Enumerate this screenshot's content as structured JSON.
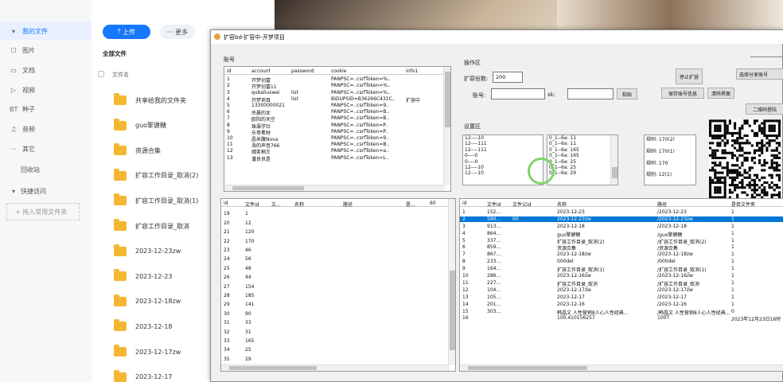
{
  "sidebar": {
    "items": [
      {
        "label": "我的文件",
        "icon": "chevron-down-icon",
        "active": true
      },
      {
        "label": "图片",
        "icon": "image-icon"
      },
      {
        "label": "文档",
        "icon": "document-icon"
      },
      {
        "label": "视频",
        "icon": "video-icon"
      },
      {
        "label": "种子",
        "icon": "bt-icon"
      },
      {
        "label": "音频",
        "icon": "headphones-icon"
      },
      {
        "label": "其它",
        "icon": "more-icon"
      },
      {
        "label": "回收站",
        "icon": ""
      },
      {
        "label": "快捷访问",
        "icon": "chevron-down-icon"
      },
      {
        "label": "+ 拖入常用文件夹",
        "icon": ""
      }
    ]
  },
  "toolbar": {
    "upload": "上传",
    "more": "更多"
  },
  "files": {
    "header": "全部文件",
    "col_name": "文件名",
    "items": [
      "共享给我的文件夹",
      "guo擎健糖",
      "资源合集",
      "扩容工作目录_取消(2)",
      "扩容工作目录_取消(1)",
      "扩容工作目录_取消",
      "2023-12-23zw",
      "2023-12-23",
      "2023-12-18zw",
      "2023-12-18",
      "2023-12-17zw",
      "2023-12-17"
    ]
  },
  "window": {
    "title": "扩容bd-扩容中-开梦项目",
    "account_label": "账号",
    "ops_label": "操作区",
    "settings_label": "设置区",
    "expand_count_label": "扩容份数:",
    "expand_count_value": "200",
    "account_field_label": "账号:",
    "sk_label": "sk:",
    "paste_btn": "粘贴",
    "stop_btn": "停止扩容",
    "save_btn": "保存账号信息",
    "clear_btn": "清除界面",
    "select_share_btn": "选择分享账号",
    "qrcode_btn": "二维码登陆",
    "acc_headers": [
      "id",
      "account",
      "password",
      "cookie",
      "info1"
    ],
    "acc_rows": [
      [
        "1",
        "开梦创富",
        "",
        "PANPSC=..csrfToken=%..",
        ""
      ],
      [
        "2",
        "开梦创富11",
        "",
        "PANPSC=..csrfToken=%..",
        ""
      ],
      [
        "3",
        "qubaliuswei",
        "list",
        "PANPSC=..csrfToken=%..",
        ""
      ],
      [
        "4",
        "开梦项目",
        "list",
        "BIDUPSID=B36266C431C..",
        "扩容中"
      ],
      [
        "5",
        "13300000021",
        "",
        "PANPSC=..csrfToken=9..",
        ""
      ],
      [
        "6",
        "杀晨的女",
        "",
        "PANPSC=..csrfToken=B..",
        ""
      ],
      [
        "7",
        "欧阳的天空",
        "",
        "PANPSC=..csrfToken=B..",
        ""
      ],
      [
        "8",
        "珠瀛学社",
        "",
        "PANPSC=..csrfToken=P..",
        ""
      ],
      [
        "9",
        "乐哥素材",
        "",
        "PANPSC=..csrfToken=P..",
        ""
      ],
      [
        "10",
        "晶禾腹Nova",
        "",
        "PANPSC=..csrfToken=9..",
        ""
      ],
      [
        "11",
        "海的声音766",
        "",
        "PANPSC=..csrfToken=B..",
        ""
      ],
      [
        "12",
        "嫣茗桐王",
        "",
        "PANPSC=..csrfToken=a..",
        ""
      ],
      [
        "13",
        "潘良良是",
        "",
        "PANPSC=..csrfToken=L..",
        ""
      ]
    ],
    "set_col1": [
      "12----10",
      "12----111",
      "12----111",
      "0----0",
      "0----0",
      "12----10",
      "12----10"
    ],
    "set_col2": [
      "0_1--6a: 11",
      "0_1--6a: 11",
      "0_1--6a: 165",
      "0_1--6a: 165",
      "0_1--6a: 25",
      "0_1--6a: 25",
      "0_1--6a: 29"
    ],
    "set_col3": [
      "规则: 170(2)",
      "",
      "规则: 170(1)",
      "",
      "规则: 170",
      "",
      "规则: 12(1)"
    ],
    "left_headers": [
      "id",
      "文件id",
      "文...",
      "名称",
      "路径",
      "是...",
      "60"
    ],
    "left_rows": [
      [
        "19",
        "1"
      ],
      [
        "20",
        "12"
      ],
      [
        "21",
        "120"
      ],
      [
        "22",
        "170"
      ],
      [
        "23",
        "46"
      ],
      [
        "24",
        "56"
      ],
      [
        "25",
        "48"
      ],
      [
        "26",
        "44"
      ],
      [
        "27",
        "154"
      ],
      [
        "28",
        "185"
      ],
      [
        "29",
        "141"
      ],
      [
        "30",
        "90"
      ],
      [
        "31",
        "33"
      ],
      [
        "32",
        "31"
      ],
      [
        "33",
        "165"
      ],
      [
        "34",
        "25"
      ],
      [
        "35",
        "29"
      ]
    ],
    "right_headers": [
      "id",
      "文件id",
      "文件父id",
      "名称",
      "路径",
      "是否文件夹"
    ],
    "right_rows": [
      [
        "1",
        "152...",
        "",
        "2023-12-23",
        "/2023-12-23",
        "1"
      ],
      [
        "2",
        "590...",
        "00",
        "2023-12-23zw",
        "/2023-12-23zw",
        "1"
      ],
      [
        "3",
        "913...",
        "",
        "2023-12-18",
        "/2023-12-18",
        "1"
      ],
      [
        "4",
        "864...",
        "",
        "guo擎健糖",
        "/guo擎健糖",
        "1"
      ],
      [
        "5",
        "337...",
        "",
        "扩容工作目录_取消(2)",
        "/扩容工作目录_取消(2)",
        "1"
      ],
      [
        "6",
        "859...",
        "",
        "资源合集",
        "/资源合集",
        "1"
      ],
      [
        "7",
        "867...",
        "",
        "2023-12-18zw",
        "/2023-12-18zw",
        "1"
      ],
      [
        "8",
        "233...",
        "",
        "000del",
        "/000del",
        "1"
      ],
      [
        "9",
        "164...",
        "",
        "扩容工作目录_取消(1)",
        "/扩容工作目录_取消(1)",
        "1"
      ],
      [
        "10",
        "286...",
        "",
        "2023-12-16zw",
        "/2023-12-16zw",
        "1"
      ],
      [
        "11",
        "227...",
        "",
        "扩容工作目录_取消",
        "/扩容工作目录_取消",
        "1"
      ],
      [
        "12",
        "104...",
        "",
        "2023-12-17zw",
        "/2023-12-17zw",
        "1"
      ],
      [
        "13",
        "105...",
        "",
        "2023-12-17",
        "/2023-12-17",
        "1"
      ],
      [
        "14",
        "201...",
        "",
        "2023-12-16",
        "/2023-12-16",
        "1"
      ],
      [
        "15",
        "303...",
        "",
        "韩晶文 人性营销8人心人性经典...",
        "/韩晶文 人性营销8人心人性经典...",
        "0"
      ],
      [
        "16",
        "",
        "",
        "100.410156257",
        "100T",
        "2023年12月23日16时"
      ]
    ]
  }
}
